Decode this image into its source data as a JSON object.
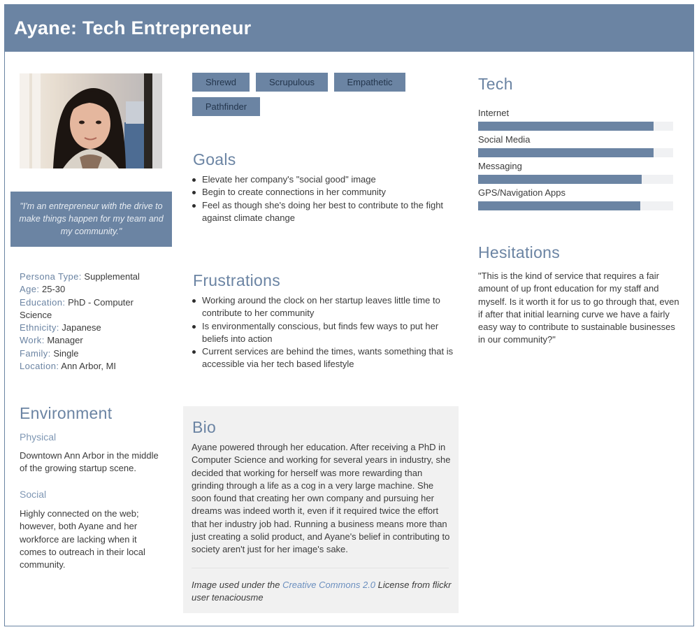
{
  "header": {
    "title": "Ayane: Tech Entrepreneur"
  },
  "quote": "\"I'm an entrepreneur with the drive to make things happen for my team and my community.\"",
  "facts": [
    {
      "key": "Persona Type:",
      "value": "Supplemental"
    },
    {
      "key": "Age:",
      "value": "25-30"
    },
    {
      "key": "Education:",
      "value": "PhD - Computer Science"
    },
    {
      "key": "Ethnicity:",
      "value": "Japanese"
    },
    {
      "key": "Work:",
      "value": "Manager"
    },
    {
      "key": "Family:",
      "value": "Single"
    },
    {
      "key": "Location:",
      "value": "Ann Arbor, MI"
    }
  ],
  "environment": {
    "title": "Environment",
    "physical_label": "Physical",
    "physical_text": "Downtown Ann Arbor in the middle of the growing startup scene.",
    "social_label": "Social",
    "social_text": "Highly connected on the web; however, both Ayane and her workforce are lacking when it comes to outreach in their local community."
  },
  "tags": [
    "Shrewd",
    "Scrupulous",
    "Empathetic",
    "Pathfinder"
  ],
  "goals": {
    "title": "Goals",
    "items": [
      "Elevate her company's \"social good\" image",
      "Begin to create connections in her community",
      "Feel as though she's doing her best to contribute to the fight against climate change"
    ]
  },
  "frustrations": {
    "title": "Frustrations",
    "items": [
      "Working around the clock on her startup leaves little time to contribute to her community",
      "Is environmentally conscious, but finds few ways to put her beliefs into action",
      "Current services are behind the times, wants something that is accessible via her tech based lifestyle"
    ]
  },
  "bio": {
    "title": "Bio",
    "text": "Ayane powered through her education. After receiving a PhD in Computer Science and working for several years in industry, she decided that working for herself was more rewarding than grinding through a life as a cog in a very large machine. She soon found that creating her own company and pursuing her dreams was indeed worth it, even if it required twice the effort that her industry job had. Running a business means more than just creating a solid product, and Ayane's belief in contributing to society aren't just for her image's sake.",
    "credit_pre": "Image used under the ",
    "credit_link": "Creative Commons 2.0",
    "credit_post": " License from flickr user tenaciousme"
  },
  "tech": {
    "title": "Tech",
    "items": [
      {
        "label": "Internet",
        "level": 0.9
      },
      {
        "label": "Social Media",
        "level": 0.9
      },
      {
        "label": "Messaging",
        "level": 0.84
      },
      {
        "label": "GPS/Navigation Apps",
        "level": 0.83
      }
    ]
  },
  "hesitations": {
    "title": "Hesitations",
    "text": "\"This is the kind of service that requires a fair amount of up front education for my staff and myself. Is it worth it for us to go through that, even if after that initial learning curve we have a fairly easy way to contribute to sustainable businesses in our community?\""
  },
  "colors": {
    "accent": "#6b84a3",
    "bio_bg": "#f1f1f1",
    "link": "#6b8fbf"
  }
}
